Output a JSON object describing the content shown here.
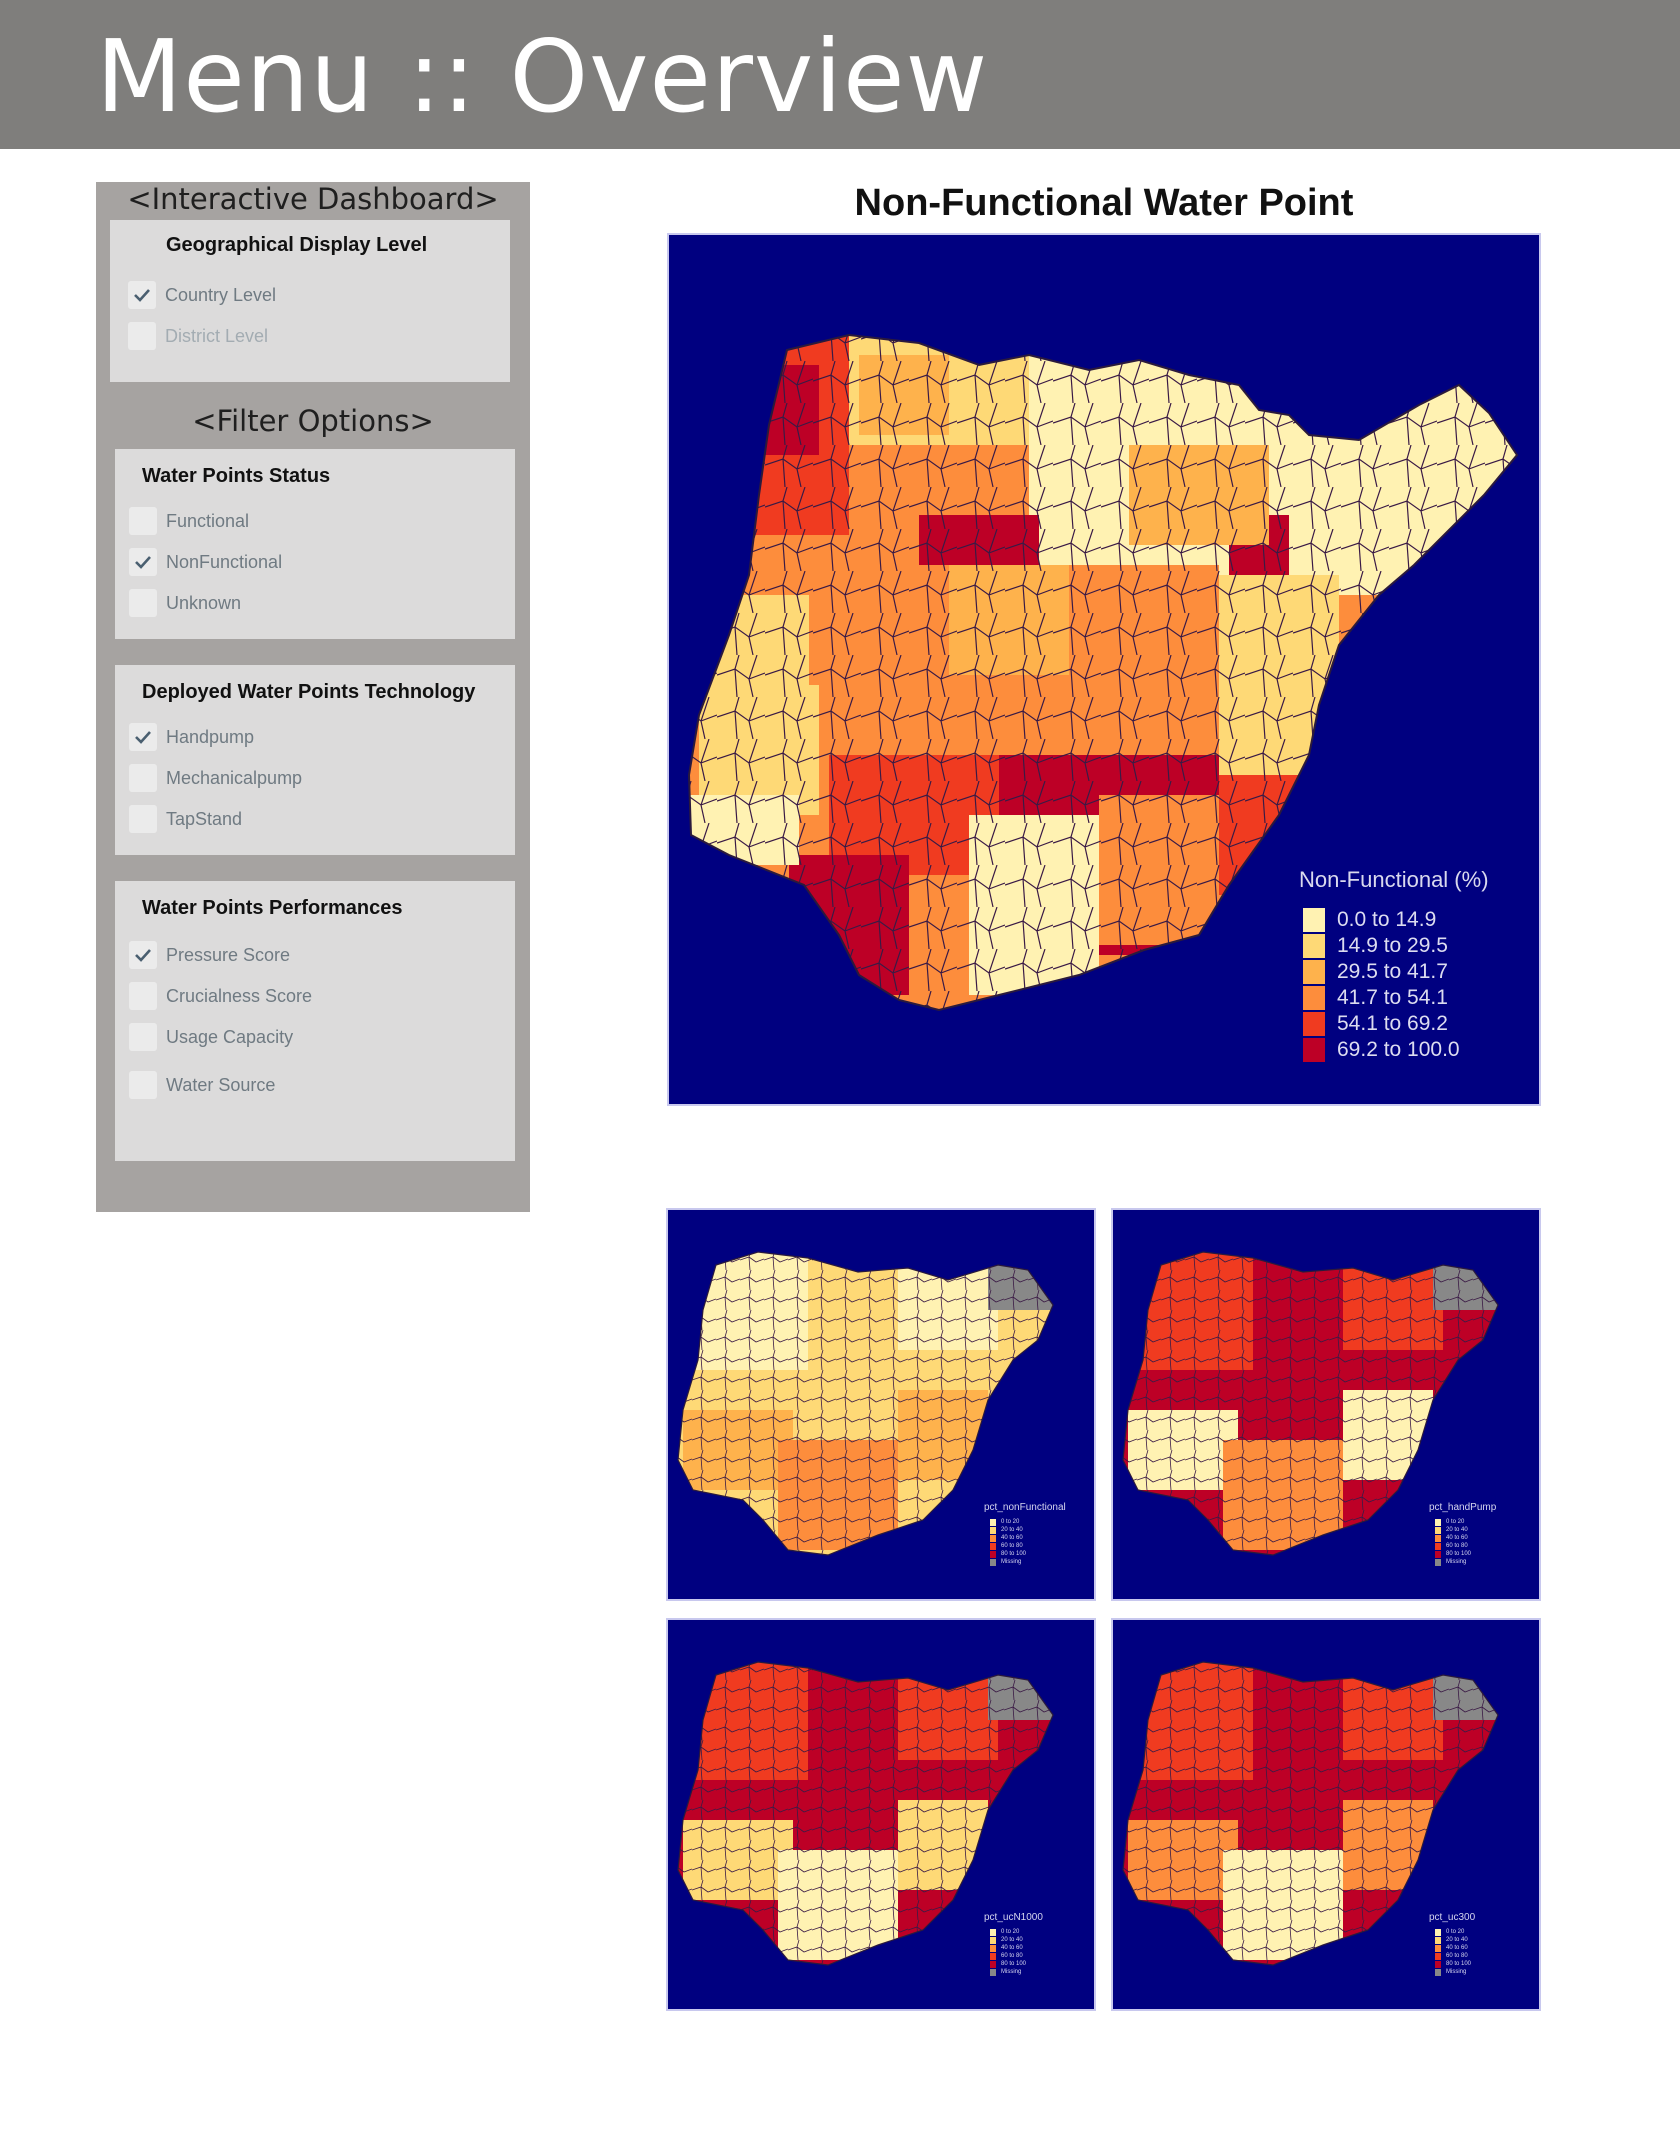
{
  "header": {
    "title": "Menu :: Overview"
  },
  "sidebar": {
    "dashboard_title": "<Interactive Dashboard>",
    "geo": {
      "title": "Geographical Display Level",
      "options": [
        {
          "label": "Country Level",
          "checked": true
        },
        {
          "label": "District Level",
          "checked": false
        }
      ]
    },
    "filter_title": "<Filter Options>",
    "status": {
      "title": "Water Points Status",
      "options": [
        {
          "label": "Functional",
          "checked": false
        },
        {
          "label": "NonFunctional",
          "checked": true
        },
        {
          "label": "Unknown",
          "checked": false
        }
      ]
    },
    "tech": {
      "title": "Deployed Water Points Technology",
      "options": [
        {
          "label": "Handpump",
          "checked": true
        },
        {
          "label": "Mechanicalpump",
          "checked": false
        },
        {
          "label": "TapStand",
          "checked": false
        }
      ]
    },
    "perf": {
      "title": "Water Points Performances",
      "options": [
        {
          "label": "Pressure Score",
          "checked": true
        },
        {
          "label": "Crucialness Score",
          "checked": false
        },
        {
          "label": "Usage Capacity",
          "checked": false
        },
        {
          "label": "Water Source",
          "checked": false
        }
      ]
    }
  },
  "main_map": {
    "title": "Non-Functional Water Point",
    "legend_title": "Non-Functional (%)",
    "legend": [
      {
        "label": "0.0 to 14.9",
        "color": "#fff2b2"
      },
      {
        "label": "14.9 to 29.5",
        "color": "#fed976"
      },
      {
        "label": "29.5 to 41.7",
        "color": "#feb24c"
      },
      {
        "label": "41.7 to 54.1",
        "color": "#fd8d3c"
      },
      {
        "label": "54.1 to 69.2",
        "color": "#f03b20"
      },
      {
        "label": "69.2 to 100.0",
        "color": "#bd0026"
      }
    ]
  },
  "small_maps": [
    {
      "legend_title": "pct_nonFunctional"
    },
    {
      "legend_title": "pct_handPump"
    },
    {
      "legend_title": "pct_ucN1000"
    },
    {
      "legend_title": "pct_uc300"
    }
  ],
  "small_legend": [
    "0 to 20",
    "20 to 40",
    "40 to 60",
    "60 to 80",
    "80 to 100",
    "Missing"
  ],
  "colors": {
    "map_bg": "#000080",
    "header_bg": "#7f7e7c",
    "sidebar_bg": "#a6a3a1",
    "box_bg": "#dcdbdb"
  }
}
